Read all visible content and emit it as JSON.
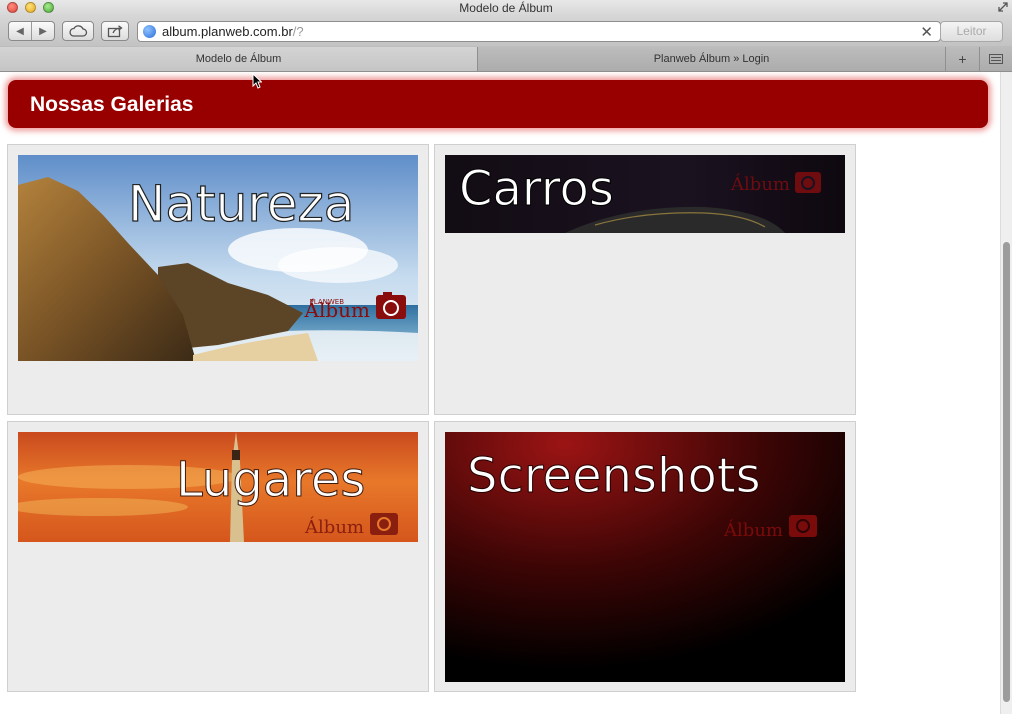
{
  "window": {
    "title": "Modelo de Álbum"
  },
  "toolbar": {
    "url_host": "album.planweb.com.br",
    "url_path": "/?",
    "reader_label": "Leitor"
  },
  "tabs": [
    {
      "label": "Modelo de Álbum",
      "active": true
    },
    {
      "label": "Planweb Álbum » Login",
      "active": false
    }
  ],
  "page": {
    "heading": "Nossas Galerias",
    "header_color": "#980000",
    "brand_word": "Álbum",
    "brand_small": "PLANWEB",
    "galleries": [
      {
        "title": "Natureza"
      },
      {
        "title": "Carros"
      },
      {
        "title": "Lugares"
      },
      {
        "title": "Screenshots"
      }
    ]
  },
  "icons": [
    "back-icon",
    "forward-icon",
    "cloud-icon",
    "share-icon",
    "globe-icon",
    "clear-icon",
    "camera-icon",
    "add-tab-icon",
    "tab-overview-icon"
  ]
}
